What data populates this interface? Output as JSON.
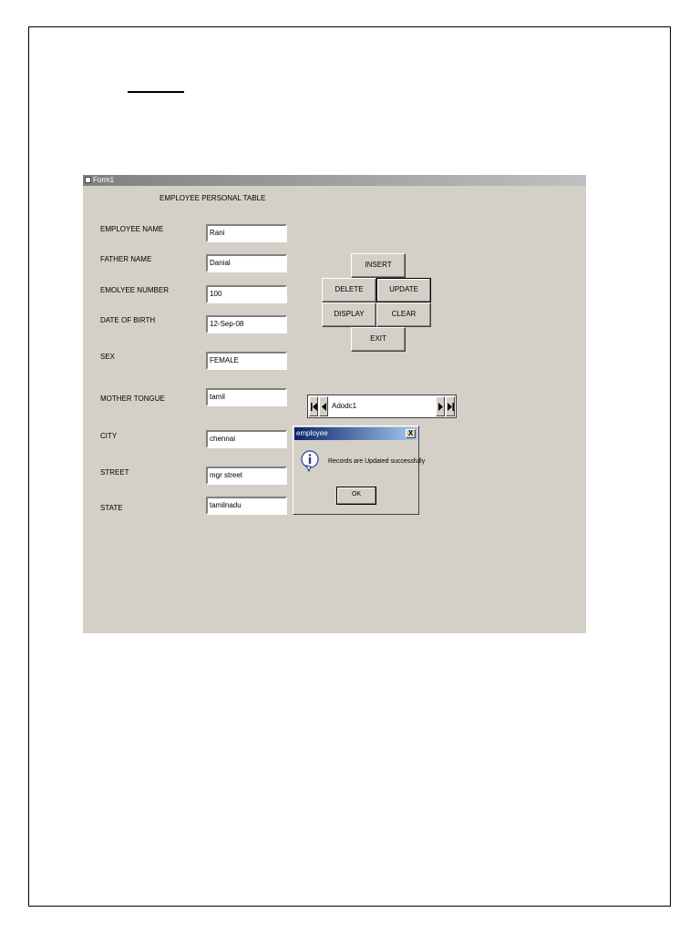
{
  "window": {
    "title": "Form1"
  },
  "form": {
    "heading": "EMPLOYEE PERSONAL TABLE",
    "fields": [
      {
        "label": "EMPLOYEE NAME",
        "value": "Rani"
      },
      {
        "label": "FATHER NAME",
        "value": "Danial"
      },
      {
        "label": "EMOLYEE NUMBER",
        "value": "100"
      },
      {
        "label": "DATE OF BIRTH",
        "value": "12-Sep-08"
      },
      {
        "label": "SEX",
        "value": "FEMALE"
      },
      {
        "label": "MOTHER TONGUE",
        "value": "tamil"
      },
      {
        "label": "CITY",
        "value": "chennai"
      },
      {
        "label": "STREET",
        "value": "mgr street"
      },
      {
        "label": "STATE",
        "value": "tamilnadu"
      }
    ]
  },
  "buttons": {
    "insert": "INSERT",
    "delete": "DELETE",
    "update": "UPDATE",
    "display": "DISPLAY",
    "clear": "CLEAR",
    "exit": "EXIT"
  },
  "adodc": {
    "caption": "Adodc1"
  },
  "msgbox": {
    "title": "employee",
    "close": "X",
    "message": "Records are Updated successfully",
    "ok": "OK"
  },
  "colors": {
    "form_bg": "#d4d0c8",
    "dialog_title": "#0a246a"
  },
  "icons": [
    "app-icon",
    "info-icon",
    "first-record-icon",
    "prev-record-icon",
    "next-record-icon",
    "last-record-icon"
  ]
}
